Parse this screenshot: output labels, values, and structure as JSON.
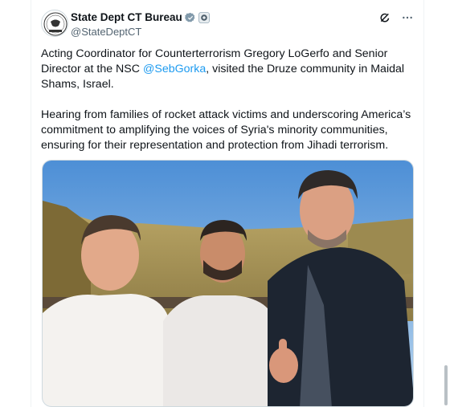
{
  "account": {
    "display_name": "State Dept CT Bureau",
    "handle": "@StateDeptCT",
    "verified": true
  },
  "post": {
    "para1_before": "Acting Coordinator for Counterterrorism Gregory LoGerfo and Senior Director at the NSC ",
    "mention": "@SebGorka",
    "para1_after": ", visited the Druze community in Maidal Shams, Israel.",
    "para2": "Hearing from families of rocket attack victims and underscoring America’s commitment to amplifying the voices of Syria's minority communities, ensuring for their representation and protection from Jihadi terrorism."
  },
  "icons": {
    "verified": "verified-badge-icon",
    "gov": "government-badge-icon",
    "grok": "grok-icon",
    "more": "more-icon"
  },
  "colors": {
    "link": "#1d9bf0",
    "secondary_text": "#536471",
    "sky": "#7db0e0"
  }
}
